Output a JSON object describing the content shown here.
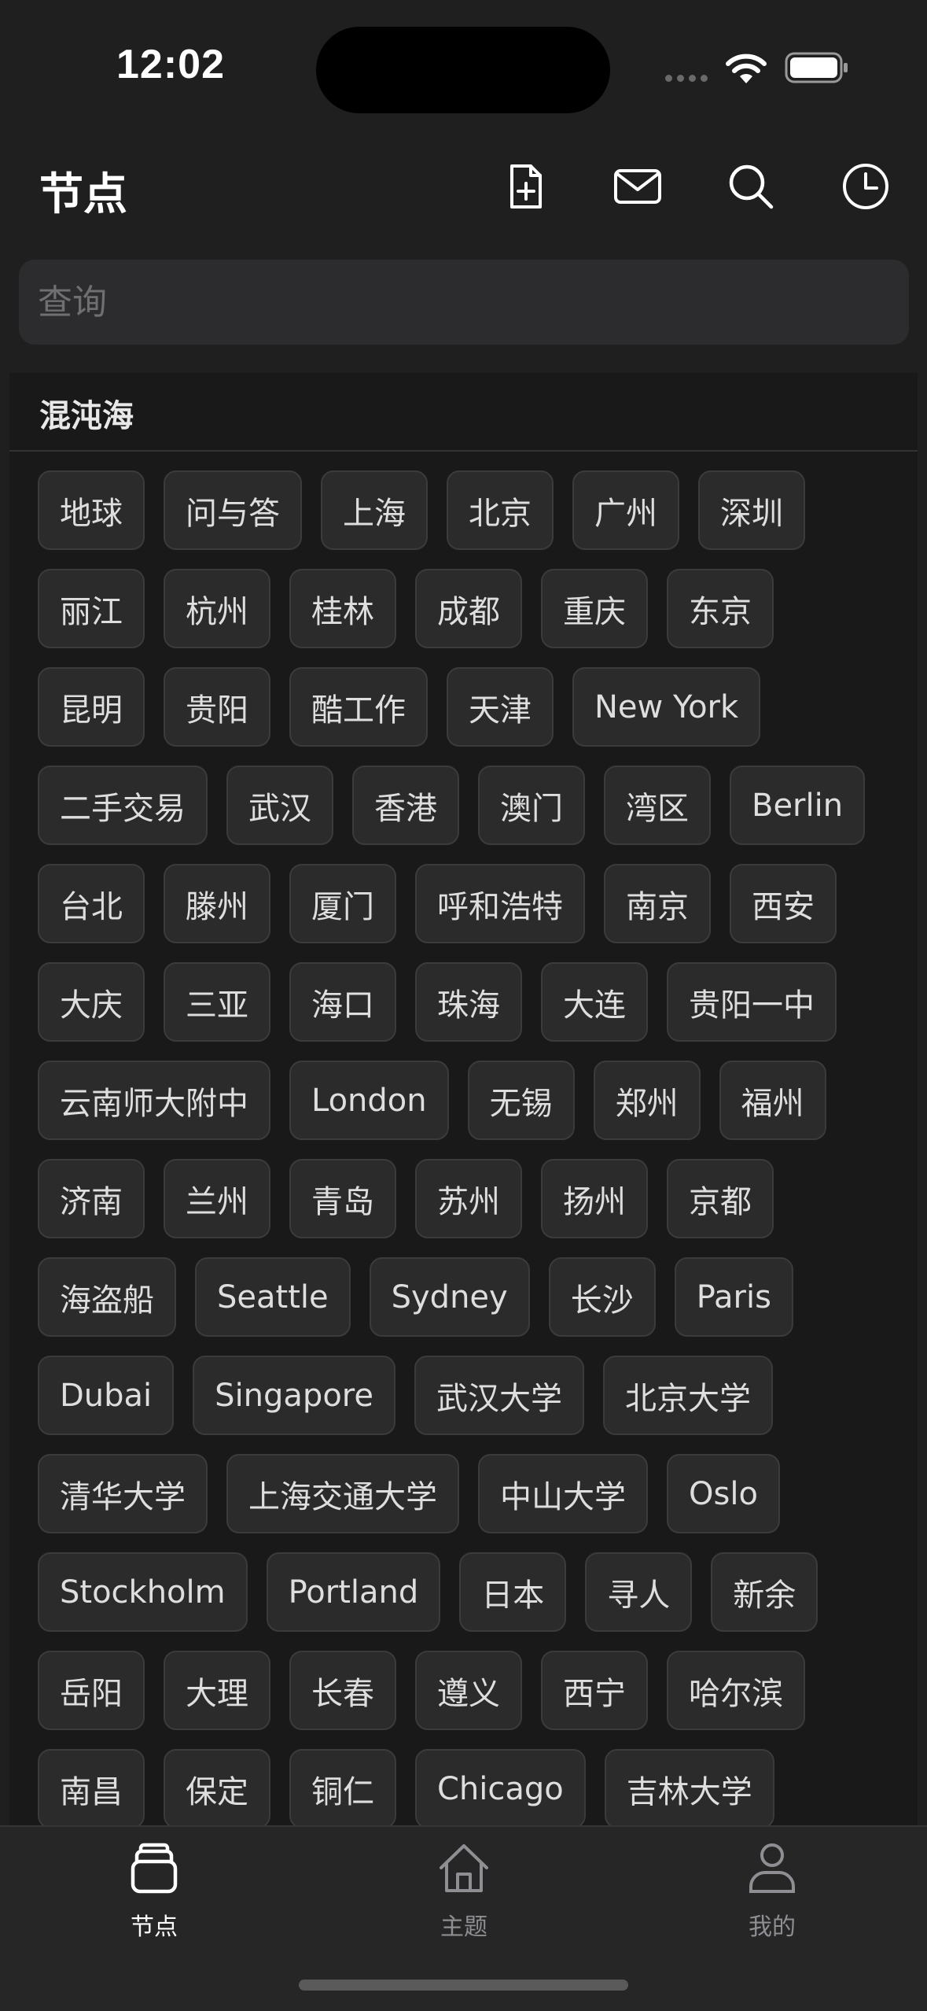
{
  "status_bar": {
    "time": "12:02"
  },
  "header": {
    "title": "节点",
    "icons": [
      "new-document-icon",
      "mail-icon",
      "search-icon",
      "history-clock-icon"
    ]
  },
  "search": {
    "placeholder": "查询",
    "value": ""
  },
  "section": {
    "title": "混沌海",
    "tags": [
      "地球",
      "问与答",
      "上海",
      "北京",
      "广州",
      "深圳",
      "丽江",
      "杭州",
      "桂林",
      "成都",
      "重庆",
      "东京",
      "昆明",
      "贵阳",
      "酷工作",
      "天津",
      "New York",
      "二手交易",
      "武汉",
      "香港",
      "澳门",
      "湾区",
      "Berlin",
      "台北",
      "滕州",
      "厦门",
      "呼和浩特",
      "南京",
      "西安",
      "大庆",
      "三亚",
      "海口",
      "珠海",
      "大连",
      "贵阳一中",
      "云南师大附中",
      "London",
      "无锡",
      "郑州",
      "福州",
      "济南",
      "兰州",
      "青岛",
      "苏州",
      "扬州",
      "京都",
      "海盗船",
      "Seattle",
      "Sydney",
      "长沙",
      "Paris",
      "Dubai",
      "Singapore",
      "武汉大学",
      "北京大学",
      "清华大学",
      "上海交通大学",
      "中山大学",
      "Oslo",
      "Stockholm",
      "Portland",
      "日本",
      "寻人",
      "新余",
      "岳阳",
      "大理",
      "长春",
      "遵义",
      "西宁",
      "哈尔滨",
      "南昌",
      "保定",
      "铜仁",
      "Chicago",
      "吉林大学"
    ]
  },
  "tabbar": {
    "items": [
      {
        "label": "节点",
        "icon": "stack-icon",
        "active": true
      },
      {
        "label": "主题",
        "icon": "home-icon",
        "active": false
      },
      {
        "label": "我的",
        "icon": "person-icon",
        "active": false
      }
    ]
  },
  "colors": {
    "background": "#1f1f1f",
    "card": "#191919",
    "tag_bg": "#2b2b2b",
    "tag_border": "#3b3b3d",
    "active": "#ffffff",
    "inactive": "#8e8e93"
  }
}
